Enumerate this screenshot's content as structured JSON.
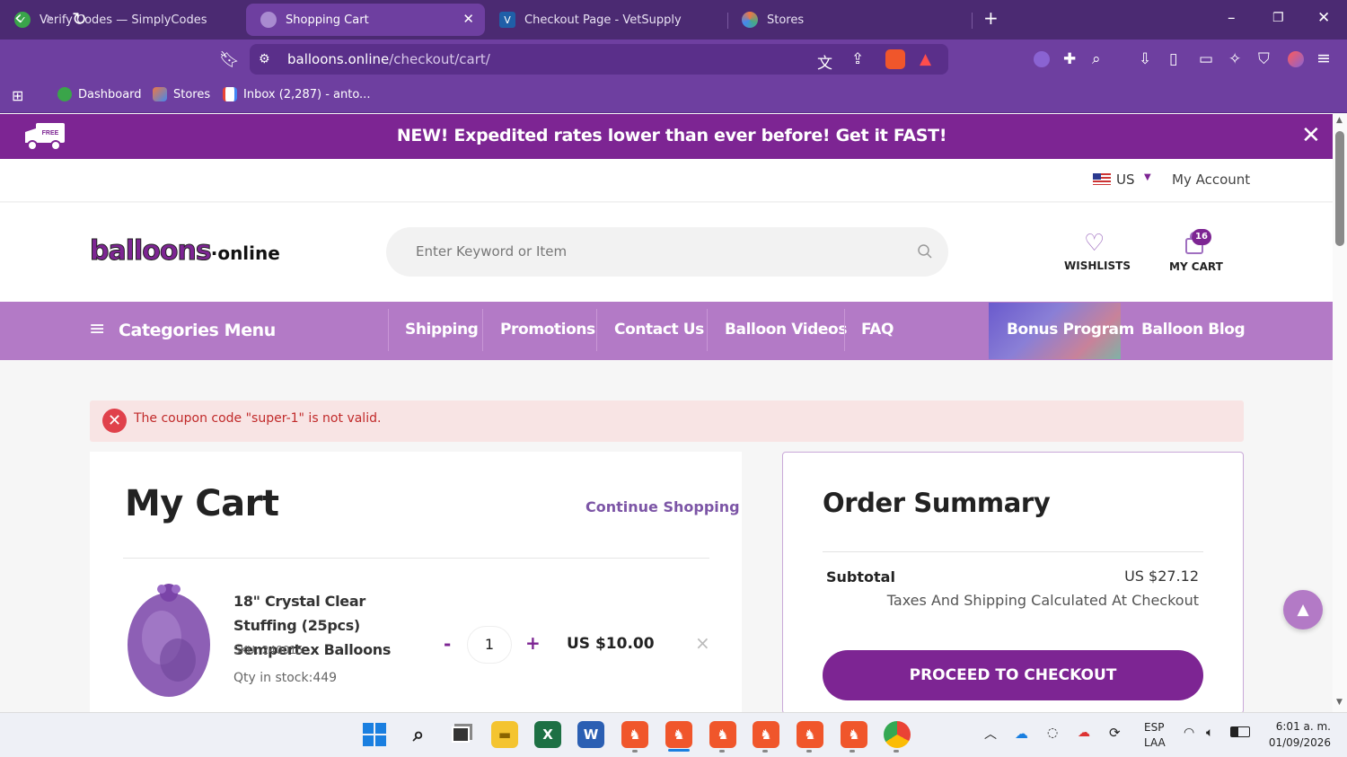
{
  "browser": {
    "tabs": [
      {
        "title": "Verify Codes — SimplyCodes",
        "active": false
      },
      {
        "title": "Shopping Cart",
        "active": true
      },
      {
        "title": "Checkout Page - VetSupply",
        "active": false
      },
      {
        "title": "Stores",
        "active": false
      }
    ],
    "url_domain": "balloons.online",
    "url_path": "/checkout/cart/",
    "bookmarks": [
      "Dashboard",
      "Stores",
      "Inbox (2,287) - anto..."
    ]
  },
  "promo": {
    "text": "NEW! Expedited rates lower than ever before! Get it FAST!",
    "truck_label": "FREE"
  },
  "topbar": {
    "country": "US",
    "account": "My Account"
  },
  "header": {
    "logo_main": "balloons",
    "logo_suffix": "·online",
    "search_placeholder": "Enter Keyword or Item",
    "wishlist_label": "WISHLISTS",
    "cart_label": "MY CART",
    "cart_count": "16"
  },
  "menu": {
    "categories": "Categories Menu",
    "items": [
      "Shipping",
      "Promotions",
      "Contact Us",
      "Balloon Videos",
      "FAQ",
      "Bonus Program",
      "Balloon Blog"
    ]
  },
  "alert": {
    "message": "The coupon code \"super-1\" is not valid."
  },
  "cart": {
    "title": "My Cart",
    "continue": "Continue Shopping",
    "item": {
      "name": "18\" Crystal Clear Stuffing (25pcs) Sempertex Balloons",
      "sku": "SKU: 240015",
      "stock": "Qty in stock:449",
      "qty_minus": "-",
      "qty": "1",
      "qty_plus": "+",
      "price": "US $10.00",
      "remove": "×"
    }
  },
  "summary": {
    "title": "Order Summary",
    "subtotal_label": "Subtotal",
    "subtotal_value": "US $27.12",
    "tax_note": "Taxes And Shipping Calculated At Checkout",
    "checkout_button": "PROCEED TO CHECKOUT"
  },
  "taskbar": {
    "lang_top": "ESP",
    "lang_bottom": "LAA",
    "time": "6:01 a. m.",
    "date": "01/09/2026"
  },
  "colors": {
    "brand_purple": "#7d2593",
    "menu_purple": "#b37ac6",
    "error_red": "#c12a2a"
  }
}
